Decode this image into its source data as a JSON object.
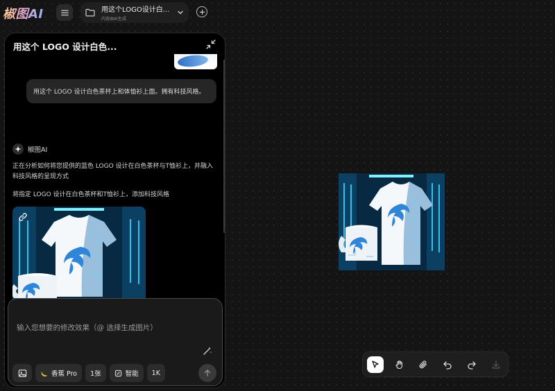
{
  "app": {
    "logo": "椒图AI"
  },
  "project": {
    "title": "用这个LOGO设计白...",
    "subtitle": "内容由AI生成"
  },
  "panel": {
    "title": "用这个 LOGO 设计白色..."
  },
  "conversation": {
    "user_message": "用这个 LOGO 设计白色茶杯上和体恤衫上面。拥有科技风格。",
    "assistant_name": "椒图AI",
    "assistant_paragraph_1": "正在分析如何将您提供的蓝色 LOGO 设计在白色茶杯与T恤衫上，并融入科技风格的呈现方式",
    "assistant_paragraph_2": "将指定 LOGO 设计在白色茶杯和T恤衫上，添加科技风格"
  },
  "composer": {
    "placeholder": "输入您想要的修改效果（@ 选择生成图片）",
    "value": "",
    "model_label": "香蕉 Pro",
    "count_label": "1张",
    "smart_label": "智能",
    "resolution_label": "1K"
  },
  "icons": {
    "menu": "menu-icon",
    "folder": "folder-icon",
    "dropdown": "chevron-down-icon",
    "new": "plus-circle-icon",
    "collapse": "collapse-arrows-icon",
    "assistant": "sparkle-icon",
    "link": "link-icon",
    "image_upload": "image-icon",
    "model": "banana-icon",
    "smart": "smart-icon",
    "magic": "magic-wand-icon",
    "send": "arrow-up-icon",
    "select_tool": "cursor-arrow-icon",
    "pan_tool": "hand-icon",
    "attach_tool": "paperclip-icon",
    "undo": "undo-icon",
    "redo": "redo-icon",
    "download": "download-icon"
  },
  "colors": {
    "background": "#141414",
    "panel": "#000000",
    "accent_blue": "#2f86d8",
    "banana": "#f3c12d"
  }
}
